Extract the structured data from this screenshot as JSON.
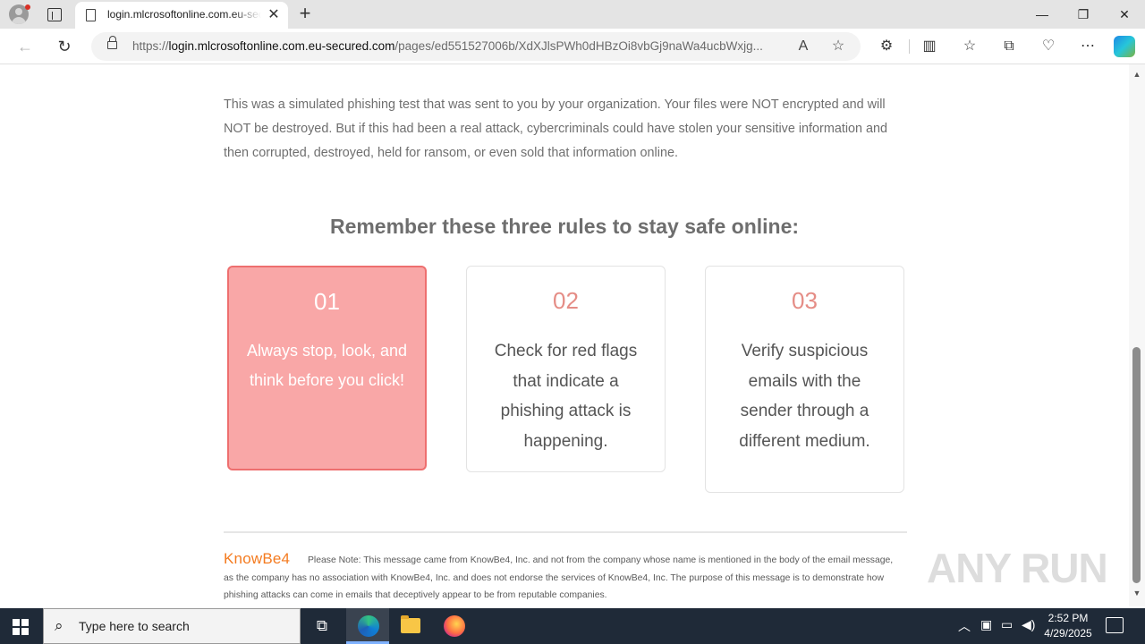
{
  "browser": {
    "tab": {
      "title": "login.mlcrosoftonline.com.eu-secured.com",
      "close_glyph": "✕"
    },
    "new_tab_glyph": "+",
    "window_controls": {
      "minimize": "—",
      "restore": "❐",
      "close": "✕"
    },
    "nav": {
      "back": "←",
      "refresh": "↻"
    },
    "address": {
      "scheme": "https://",
      "host": "login.mlcrosoftonline.com.eu-secured.com",
      "path": "/pages/ed551527006b/XdXJlsPWh0dHBzOi8vbGj9naWa4ucbWxjg..."
    },
    "omni_icons": [
      "read-aloud-icon",
      "favorite-star-icon"
    ],
    "toolbar_icons": [
      "extensions-icon",
      "split-screen-icon",
      "favorites-icon",
      "collections-icon",
      "browser-essentials-icon",
      "more-icon",
      "copilot-icon"
    ]
  },
  "page": {
    "intro": "This was a simulated phishing test that was sent to you by your organization. Your files were NOT encrypted and will NOT be destroyed. But if this had been a real attack, cybercriminals could have stolen your sensitive information and then corrupted, destroyed, held for ransom, or even sold that information online.",
    "rules_heading": "Remember these three rules to stay safe online:",
    "rules": [
      {
        "number": "01",
        "text": "Always stop, look, and think before you click!"
      },
      {
        "number": "02",
        "text": "Check for red flags that indicate a phishing attack is happening."
      },
      {
        "number": "03",
        "text": "Verify suspicious emails with the sender through a different medium."
      }
    ],
    "footer": {
      "logo": "KnowBe4",
      "note": "Please Note: This message came from KnowBe4, Inc. and not from the company whose name is mentioned in the body of the email message, as the company has no association with KnowBe4, Inc. and does not endorse the services of KnowBe4, Inc. The purpose of this message is to demonstrate how phishing attacks can come in emails that deceptively appear to be from reputable companies."
    },
    "colors": {
      "active_card_bg": "#f9a7a7",
      "active_card_border": "#ee6f6f",
      "number_accent": "#e58d86",
      "logo_orange": "#f47b20"
    }
  },
  "watermark": "ANY RUN",
  "taskbar": {
    "search_placeholder": "Type here to search",
    "apps": [
      "task-view-icon",
      "edge-icon",
      "file-explorer-icon",
      "firefox-icon"
    ],
    "clock": {
      "time": "2:52 PM",
      "date": "4/29/2025"
    }
  }
}
